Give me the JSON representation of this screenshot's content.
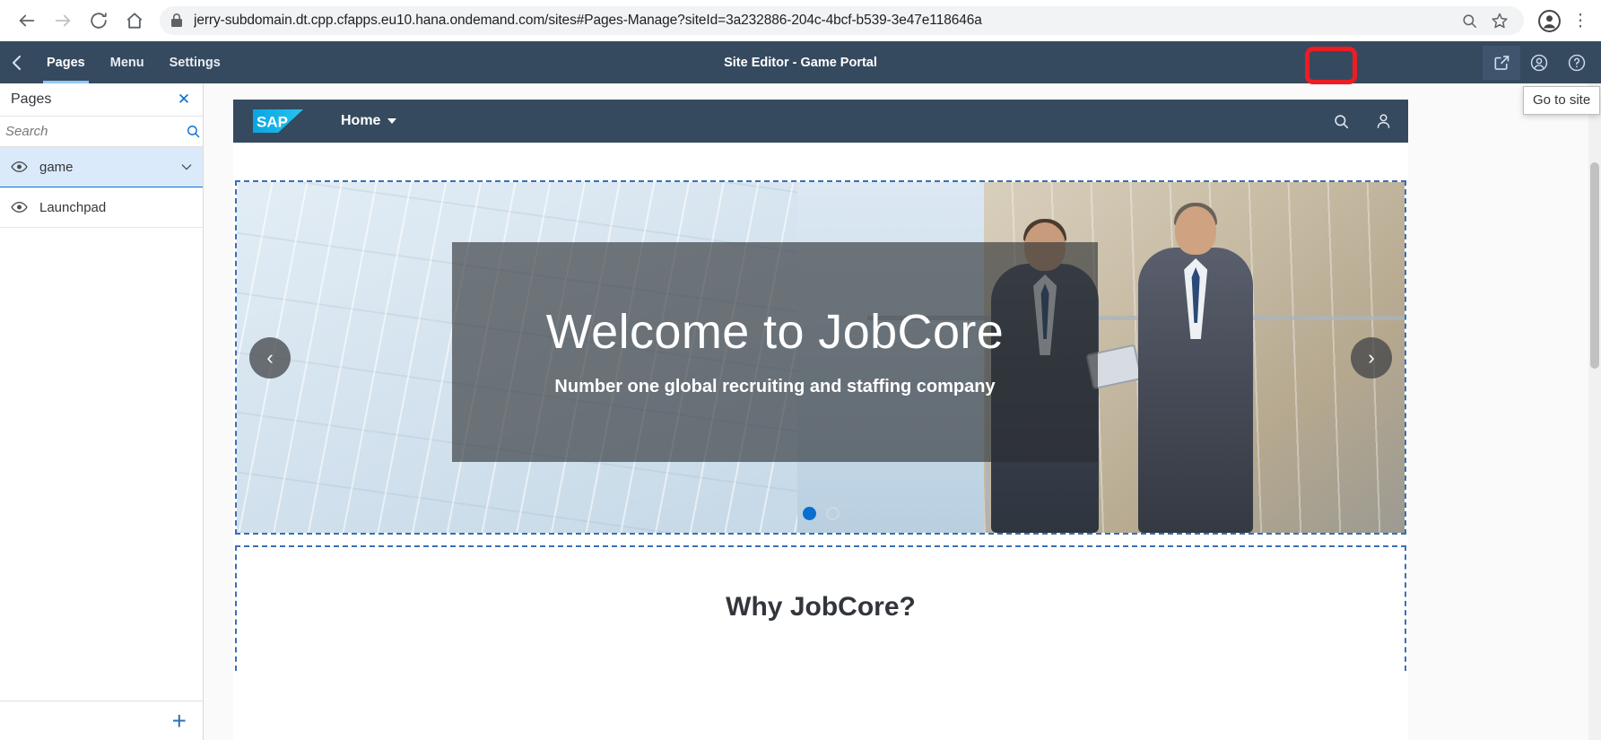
{
  "browser": {
    "url": "jerry-subdomain.dt.cpp.cfapps.eu10.hana.ondemand.com/sites#Pages-Manage?siteId=3a232886-204c-4bcf-b539-3e47e118646a",
    "back_icon": "arrow-left-icon",
    "forward_icon": "arrow-right-icon",
    "reload_icon": "reload-icon",
    "home_icon": "home-icon",
    "lock_icon": "lock-icon",
    "zoom_icon": "search-zoom-icon",
    "bookmark_icon": "star-icon",
    "profile_icon": "profile-avatar-icon",
    "menu_icon": "three-dot-menu-icon"
  },
  "app_header": {
    "title": "Site Editor - Game Portal",
    "back_label": "Back",
    "tabs": [
      {
        "label": "Pages",
        "active": true
      },
      {
        "label": "Menu",
        "active": false
      },
      {
        "label": "Settings",
        "active": false
      }
    ],
    "actions": [
      {
        "name": "go-to-site",
        "icon": "external-link-icon",
        "highlighted": true
      },
      {
        "name": "user-account",
        "icon": "user-circle-icon",
        "highlighted": false
      },
      {
        "name": "help",
        "icon": "question-circle-icon",
        "highlighted": false
      }
    ],
    "tooltip": "Go to site"
  },
  "side_panel": {
    "title": "Pages",
    "close_label": "✕",
    "search": {
      "placeholder": "Search",
      "value": ""
    },
    "items": [
      {
        "label": "game",
        "selected": true,
        "expandable": true,
        "visibility_icon": "eye-icon"
      },
      {
        "label": "Launchpad",
        "selected": false,
        "expandable": false,
        "visibility_icon": "eye-icon"
      }
    ],
    "add_label": "+"
  },
  "preview": {
    "shellbar": {
      "logo_text": "SAP",
      "home_label": "Home",
      "search_icon": "search-icon",
      "user_icon": "user-icon"
    },
    "hero": {
      "title": "Welcome to JobCore",
      "subtitle": "Number one global recruiting and staffing company",
      "prev_label": "‹",
      "next_label": "›",
      "dots": [
        {
          "active": true
        },
        {
          "active": false
        }
      ]
    },
    "why_section": {
      "title": "Why JobCore?"
    }
  },
  "colors": {
    "shell_dark": "#354a5f",
    "accent_blue": "#0a6ed1",
    "highlight_red": "#ee1c25",
    "selection_blue": "#dbeafb",
    "sap_logo_blue": "#13b5ea"
  }
}
